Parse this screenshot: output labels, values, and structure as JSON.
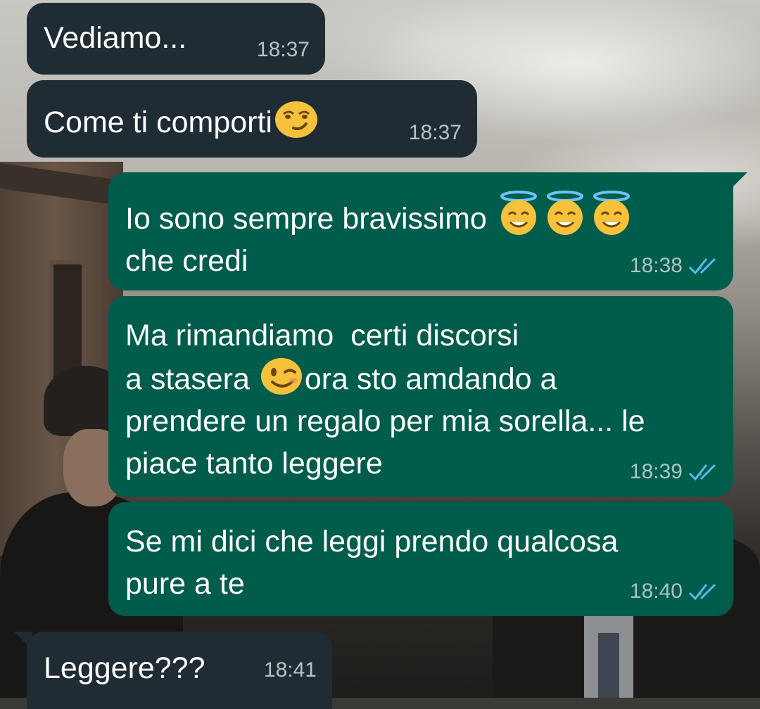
{
  "messages": [
    {
      "id": "m1",
      "direction": "incoming",
      "text": "Vediamo...",
      "time": "18:37"
    },
    {
      "id": "m2",
      "direction": "incoming",
      "text_before_emoji": "Come ti comporti",
      "emoji": "smirking-face",
      "time": "18:37"
    },
    {
      "id": "m3",
      "direction": "outgoing",
      "line1_text": "Io sono sempre bravissimo ",
      "line1_emojis": [
        "smiling-face-with-halo",
        "smiling-face-with-halo",
        "smiling-face-with-halo"
      ],
      "line2_text": "che credi",
      "time": "18:38",
      "status": "read"
    },
    {
      "id": "m4",
      "direction": "outgoing",
      "line1": "Ma rimandiamo  certi discorsi",
      "line2_before_emoji": "a stasera ",
      "emoji": "winking-face",
      "line2_after_emoji": "ora sto amdando a",
      "line3": "prendere un regalo per mia sorella... le",
      "line4": "piace tanto leggere",
      "time": "18:39",
      "status": "read"
    },
    {
      "id": "m5",
      "direction": "outgoing",
      "line1": "Se mi dici che leggi prendo qualcosa",
      "line2": "pure a te",
      "time": "18:40",
      "status": "read"
    },
    {
      "id": "m6",
      "direction": "incoming",
      "text": "Leggere???",
      "time": "18:41"
    }
  ],
  "colors": {
    "incoming_bubble": "#202c33",
    "outgoing_bubble": "#005c4b",
    "read_tick": "#53bdeb",
    "text": "#ffffff"
  }
}
